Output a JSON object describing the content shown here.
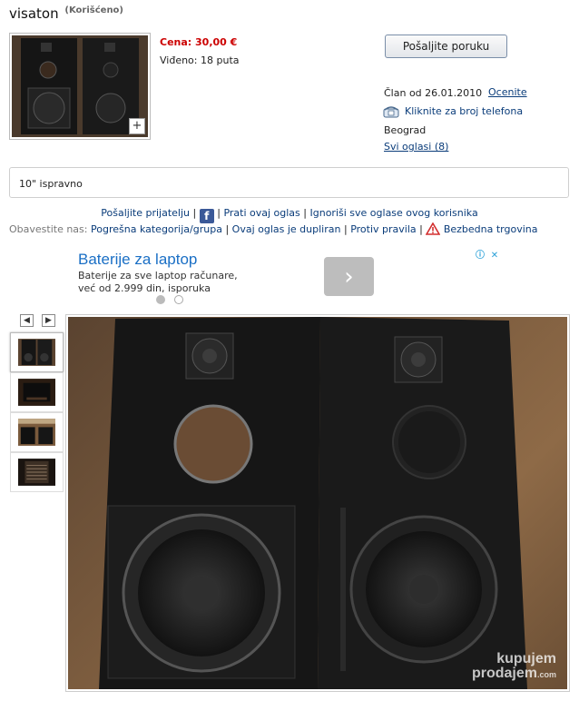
{
  "listing": {
    "title": "visaton",
    "condition": "(Korišćeno)",
    "price": "Cena: 30,00 €",
    "views": "Viđeno: 18 puta",
    "description": "10\" ispravno"
  },
  "seller": {
    "message_button": "Pošaljite poruku",
    "member_since": "Član od 26.01.2010",
    "rate_link": "Ocenite",
    "phone_link": "Kliknite za broj telefona",
    "city": "Beograd",
    "all_ads": "Svi oglasi (8)"
  },
  "actions": {
    "send_friend": "Pošaljite prijatelju",
    "follow": "Prati ovaj oglas",
    "ignore": "Ignoriši sve oglase ovog korisnika",
    "report_label": "Obavestite nas:",
    "wrong_category": "Pogrešna kategorija/grupa",
    "duplicate": "Ovaj oglas je dupliran",
    "against_rules": "Protiv pravila",
    "safe_trade": "Bezbedna trgovina",
    "separator": "|",
    "fb_letter": "f"
  },
  "ad": {
    "title": "Baterije za laptop",
    "text_line1": "Baterije za sve laptop računare,",
    "text_line2": "već od 2.999 din, isporuka",
    "arrow": "›",
    "info": "ⓘ",
    "close": "✕"
  },
  "gallery": {
    "prev": "◀",
    "next": "▶",
    "plus": "+",
    "thumb_count": 4,
    "watermark_line1": "kupujem",
    "watermark_line2": "prodajem",
    "watermark_suffix": ".com"
  },
  "colors": {
    "price": "#cc0000",
    "link": "#0a3c7a",
    "ad_title": "#1a6fc5",
    "facebook": "#3b5998",
    "warning": "#d32f2f"
  },
  "icons": [
    "phone-icon",
    "facebook-icon",
    "warning-icon",
    "info-icon",
    "close-icon",
    "chevron-right-icon",
    "arrow-left-icon",
    "arrow-right-icon",
    "plus-icon"
  ]
}
